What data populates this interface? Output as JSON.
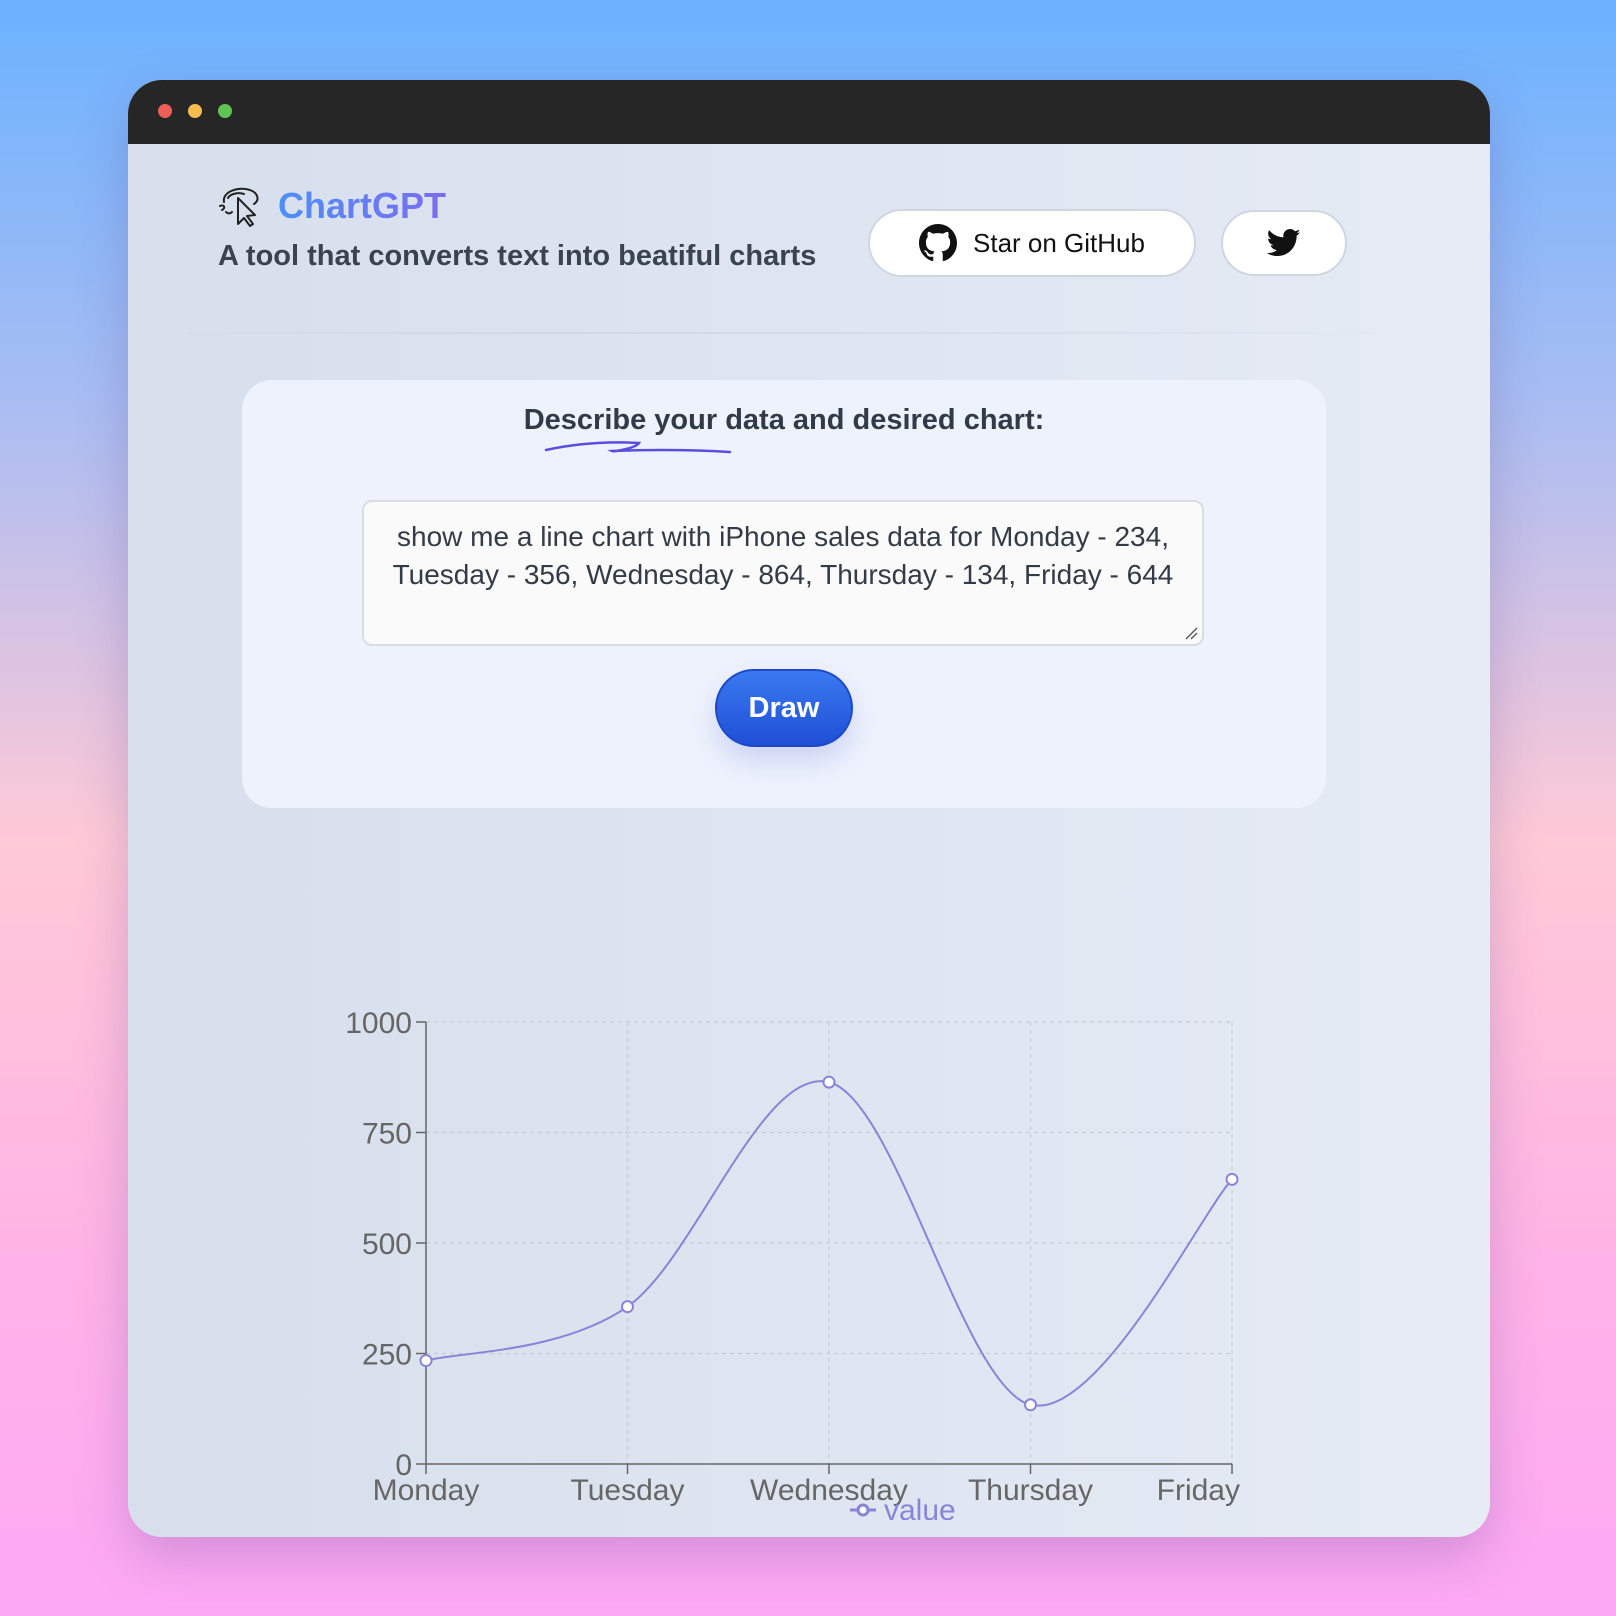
{
  "header": {
    "brand": "ChartGPT",
    "tagline": "A tool that converts text into beatiful charts",
    "github_button": "Star on GitHub"
  },
  "main": {
    "prompt_label": "Describe your data and desired chart:",
    "prompt_value": "show me a line chart with iPhone sales data for Monday - 234, Tuesday - 356, Wednesday - 864, Thursday - 134, Friday - 644",
    "draw_button": "Draw"
  },
  "colors": {
    "accent": "#1f4fd6",
    "series": "#8884d8"
  },
  "chart_data": {
    "type": "line",
    "categories": [
      "Monday",
      "Tuesday",
      "Wednesday",
      "Thursday",
      "Friday"
    ],
    "series": [
      {
        "name": "value",
        "values": [
          234,
          356,
          864,
          134,
          644
        ]
      }
    ],
    "yticks": [
      0,
      250,
      500,
      750,
      1000
    ],
    "ylim": [
      0,
      1000
    ],
    "grid": true,
    "legend": "bottom"
  }
}
